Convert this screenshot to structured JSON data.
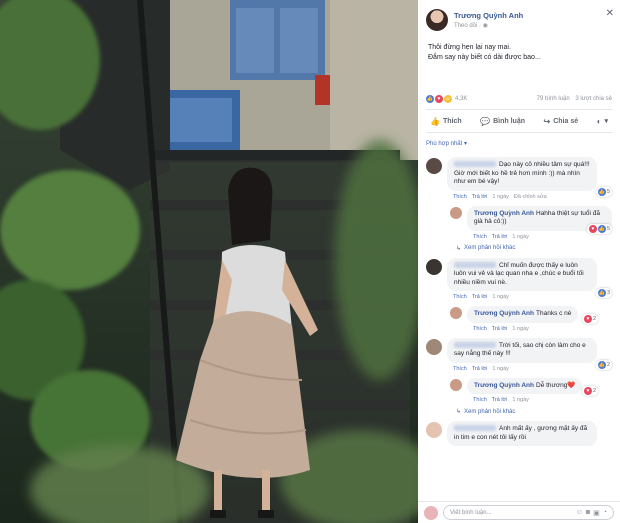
{
  "post": {
    "author": "Trương Quỳnh Anh",
    "follow_label": "Theo dõi",
    "text_line1": "Thôi đừng hẹn lại nay mai.",
    "text_line2": "Đắm say này biết có dài được bao...",
    "reaction_count": "4,3K",
    "comment_count": "79 bình luận",
    "share_count": "3 lượt chia sẻ"
  },
  "actions": {
    "like": "Thích",
    "comment": "Bình luận",
    "share": "Chia sẻ"
  },
  "sort_label": "Phù hợp nhất",
  "comments": [
    {
      "text": "Dạo này cô nhiều tâm sự quá!!! Giờ mới biết ko hề trẻ hơn mình :)) mà nhìn như em bé vậy!",
      "like": "Thích",
      "reply": "Trả lời",
      "time": "1 ngày",
      "edited": "Đã chỉnh sửa",
      "reactions": "5"
    },
    {
      "name": "Trương Quỳnh Anh",
      "text": "Hahha thiệt sự tuổi đã già hả cô:))",
      "like": "Thích",
      "reply": "Trả lời",
      "time": "1 ngày",
      "reactions": "5"
    },
    {
      "text": "Chỉ muốn được thấy e luôn luôn vui vẻ và lạc quan nha e ,chúc e buổi tối nhiều niềm vui nè.",
      "like": "Thích",
      "reply": "Trả lời",
      "time": "1 ngày",
      "reactions": "3"
    },
    {
      "name": "Trương Quỳnh Anh",
      "text": "Thanks c nè",
      "like": "Thích",
      "reply": "Trả lời",
      "time": "1 ngày",
      "reactions": "2"
    },
    {
      "text": "Trời tối, sao chị còn làm cho e say nắng thế này !!!",
      "like": "Thích",
      "reply": "Trả lời",
      "time": "1 ngày",
      "reactions": "2"
    },
    {
      "name": "Trương Quỳnh Anh",
      "text": "Dễ thương❤️",
      "like": "Thích",
      "reply": "Trả lời",
      "time": "1 ngày",
      "reactions": "2"
    },
    {
      "text": "Anh mất ấy , gương mặt ấy đã in tim e con nét tôi lấy rồi"
    }
  ],
  "see_more_replies": "Xem phản hồi khác",
  "composer_placeholder": "Viết bình luận..."
}
